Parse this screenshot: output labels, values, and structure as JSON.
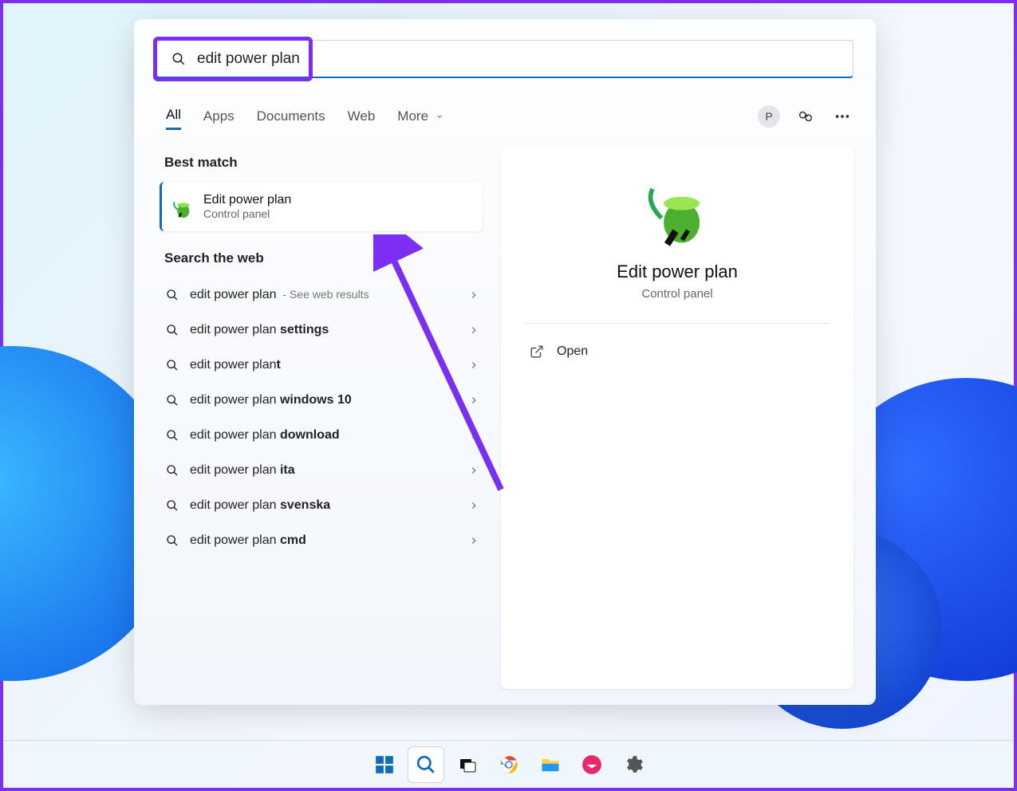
{
  "search": {
    "query": "edit power plan"
  },
  "tabs": {
    "items": [
      "All",
      "Apps",
      "Documents",
      "Web",
      "More"
    ],
    "active_index": 0
  },
  "topright": {
    "avatar_initial": "P"
  },
  "left": {
    "best_match_heading": "Best match",
    "best_match": {
      "title": "Edit power plan",
      "subtitle": "Control panel"
    },
    "search_web_heading": "Search the web",
    "web_items": [
      {
        "prefix": "edit power plan",
        "bold": "",
        "extra": "See web results"
      },
      {
        "prefix": "edit power plan ",
        "bold": "settings",
        "extra": ""
      },
      {
        "prefix": "edit power plan",
        "bold": "t",
        "extra": ""
      },
      {
        "prefix": "edit power plan ",
        "bold": "windows 10",
        "extra": ""
      },
      {
        "prefix": "edit power plan ",
        "bold": "download",
        "extra": ""
      },
      {
        "prefix": "edit power plan ",
        "bold": "ita",
        "extra": ""
      },
      {
        "prefix": "edit power plan ",
        "bold": "svenska",
        "extra": ""
      },
      {
        "prefix": "edit power plan ",
        "bold": "cmd",
        "extra": ""
      }
    ]
  },
  "preview": {
    "title": "Edit power plan",
    "subtitle": "Control panel",
    "open_label": "Open"
  },
  "colors": {
    "accent": "#0f6cbd",
    "annotation": "#7b2ff2"
  }
}
